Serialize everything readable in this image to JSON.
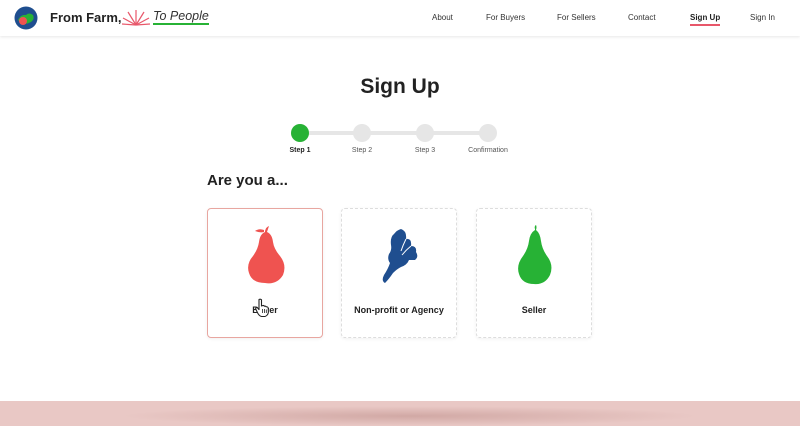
{
  "header": {
    "brand": "From Farm,",
    "tagline": "To People",
    "nav": [
      {
        "label": "About"
      },
      {
        "label": "For Buyers"
      },
      {
        "label": "For Sellers"
      },
      {
        "label": "Contact"
      },
      {
        "label": "Sign Up",
        "active": true
      },
      {
        "label": "Sign In"
      }
    ]
  },
  "page": {
    "title": "Sign Up",
    "question": "Are you a..."
  },
  "stepper": {
    "current": 1,
    "steps": [
      {
        "label": "Step 1"
      },
      {
        "label": "Step 2"
      },
      {
        "label": "Step 3"
      },
      {
        "label": "Confirmation"
      }
    ]
  },
  "options": [
    {
      "label": "Buyer",
      "icon": "red-pear-icon",
      "color": "#ef5350",
      "selected": true
    },
    {
      "label": "Non-profit or Agency",
      "icon": "blue-leaf-icon",
      "color": "#1f4e8f"
    },
    {
      "label": "Seller",
      "icon": "green-pear-icon",
      "color": "#27b235"
    }
  ],
  "colors": {
    "accent_green": "#27b235",
    "accent_pink": "#e8576a",
    "footer": "#e9c8c5"
  }
}
